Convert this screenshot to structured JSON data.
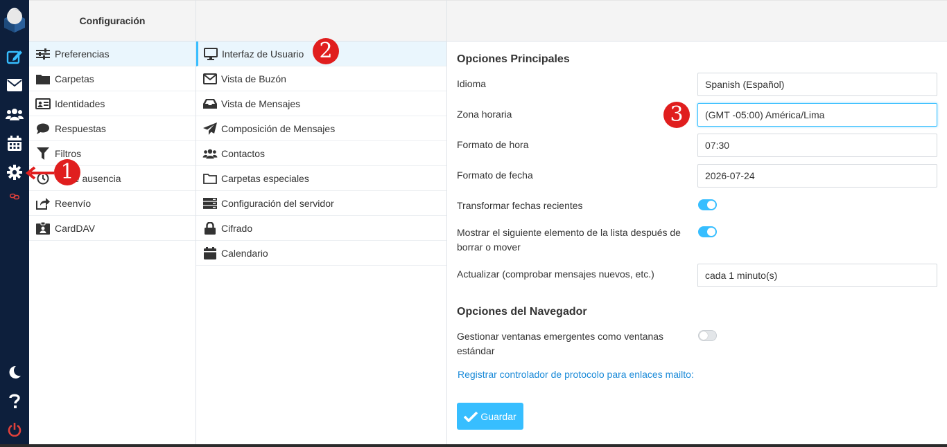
{
  "rail": {
    "items": [
      {
        "name": "logo",
        "icon": "roundcube-logo-icon"
      },
      {
        "name": "compose",
        "icon": "compose-icon"
      },
      {
        "name": "mail",
        "icon": "envelope-icon"
      },
      {
        "name": "contacts",
        "icon": "users-icon"
      },
      {
        "name": "calendar",
        "icon": "calendar-icon"
      },
      {
        "name": "settings",
        "icon": "gear-icon"
      },
      {
        "name": "link",
        "icon": "chain-link-icon"
      },
      {
        "name": "dark-mode",
        "icon": "moon-icon"
      },
      {
        "name": "help",
        "icon": "question-icon"
      },
      {
        "name": "logout",
        "icon": "power-icon"
      }
    ]
  },
  "settings_panel": {
    "title": "Configuración",
    "items": [
      {
        "label": "Preferencias",
        "icon": "sliders-icon",
        "selected": true
      },
      {
        "label": "Carpetas",
        "icon": "folder-icon"
      },
      {
        "label": "Identidades",
        "icon": "id-card-icon"
      },
      {
        "label": "Respuestas",
        "icon": "comment-icon"
      },
      {
        "label": "Filtros",
        "icon": "filter-icon"
      },
      {
        "label": "de ausencia",
        "icon": "clock-icon"
      },
      {
        "label": "Reenvío",
        "icon": "share-icon"
      },
      {
        "label": "CardDAV",
        "icon": "address-book-icon"
      }
    ]
  },
  "sections_panel": {
    "items": [
      {
        "label": "Interfaz de Usuario",
        "icon": "monitor-icon",
        "selected": true
      },
      {
        "label": "Vista de Buzón",
        "icon": "envelope-outline-icon"
      },
      {
        "label": "Vista de Mensajes",
        "icon": "inbox-icon"
      },
      {
        "label": "Composición de Mensajes",
        "icon": "paper-plane-icon"
      },
      {
        "label": "Contactos",
        "icon": "users-icon"
      },
      {
        "label": "Carpetas especiales",
        "icon": "folder-outline-icon"
      },
      {
        "label": "Configuración del servidor",
        "icon": "server-icon"
      },
      {
        "label": "Cifrado",
        "icon": "lock-icon"
      },
      {
        "label": "Calendario",
        "icon": "calendar-icon"
      }
    ]
  },
  "form": {
    "main_title": "Opciones Principales",
    "language_label": "Idioma",
    "language_value": "Spanish (Español)",
    "timezone_label": "Zona horaria",
    "timezone_value": "(GMT -05:00) América/Lima",
    "time_format_label": "Formato de hora",
    "time_format_value": "07:30",
    "date_format_label": "Formato de fecha",
    "date_format_value": "2026-07-24",
    "pretty_date_label": "Transformar fechas recientes",
    "pretty_date_on": true,
    "next_item_label": "Mostrar el siguiente elemento de la lista después de borrar o mover",
    "next_item_on": true,
    "refresh_label": "Actualizar (comprobar mensajes nuevos, etc.)",
    "refresh_value": "cada 1 minuto(s)",
    "browser_title": "Opciones del Navegador",
    "popups_label": "Gestionar ventanas emergentes como ventanas estándar",
    "popups_on": false,
    "mailto_link": "Registrar controlador de protocolo para enlaces mailto:",
    "save_label": "Guardar"
  },
  "annotations": {
    "marker1": "1",
    "marker2": "2",
    "marker3": "3"
  },
  "colors": {
    "rail_bg": "#0d1f3c",
    "accent": "#37beff",
    "selected_bg": "#eaf6fd",
    "marker": "#e01e1e",
    "logout": "#e0413b",
    "link": "#1a8ad8"
  }
}
